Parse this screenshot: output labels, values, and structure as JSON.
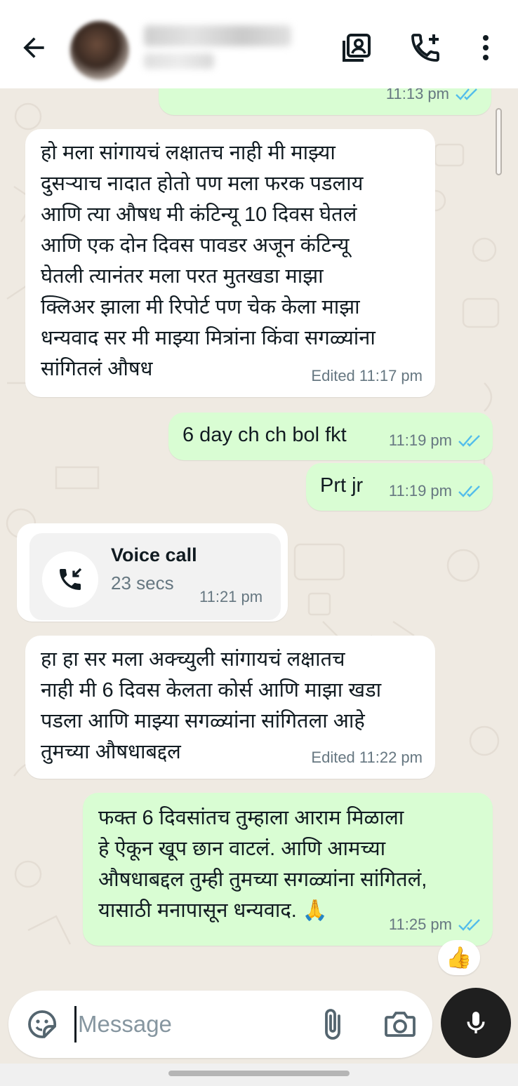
{
  "header": {
    "contact_name": "",
    "back_icon": "arrow-left-icon",
    "icons": [
      "contact-card-icon",
      "add-call-icon",
      "more-vert-icon"
    ]
  },
  "messages": [
    {
      "id": "m0",
      "direction": "out",
      "text": "",
      "time": "11:13 pm",
      "read": true
    },
    {
      "id": "m1",
      "direction": "in",
      "text": "हो मला सांगायचं लक्षातच नाही मी माझ्या\nदुसऱ्याच नादात होतो पण मला फरक पडलाय\nआणि त्या औषध मी कंटिन्यू 10 दिवस घेतलं\nआणि एक दोन दिवस पावडर अजून कंटिन्यू\nघेतली त्यानंतर मला परत मुतखडा माझा\nक्लिअर झाला मी रिपोर्ट पण चेक केला माझा\nधन्यवाद सर मी माझ्या मित्रांना किंवा सगळ्यांना\nसांगितलं औषध",
      "meta": "Edited 11:17 pm"
    },
    {
      "id": "m2",
      "direction": "out",
      "text": "6 day ch ch bol fkt",
      "time": "11:19 pm",
      "read": true
    },
    {
      "id": "m3",
      "direction": "out",
      "text": "Prt jr",
      "time": "11:19 pm",
      "read": true
    },
    {
      "id": "m4",
      "direction": "in",
      "type": "call",
      "title": "Voice call",
      "duration": "23 secs",
      "time": "11:21 pm",
      "icon": "incoming-call-icon"
    },
    {
      "id": "m5",
      "direction": "in",
      "text": "हा हा सर मला अक्च्युली सांगायचं लक्षातच\nनाही मी 6 दिवस केलता कोर्स आणि माझा खडा\nपडला आणि माझ्या सगळ्यांना सांगितला आहे\nतुमच्या औषधाबद्दल",
      "meta": "Edited 11:22 pm"
    },
    {
      "id": "m6",
      "direction": "out",
      "text": "फक्त 6 दिवसांतच तुम्हाला आराम मिळाला\nहे ऐकून खूप छान वाटलं. आणि आमच्या\nऔषधाबद्दल तुम्ही तुमच्या सगळ्यांना सांगितलं,\nयासाठी मनापासून धन्यवाद. 🙏",
      "time": "11:25 pm",
      "read": true,
      "reaction": "👍"
    }
  ],
  "composer": {
    "placeholder": "Message",
    "icons": [
      "sticker-emoji-icon",
      "attach-icon",
      "camera-icon",
      "mic-icon"
    ]
  },
  "colors": {
    "incoming": "#ffffff",
    "outgoing": "#d9fdd3",
    "tick": "#53bdeb",
    "background": "#efeae2"
  }
}
